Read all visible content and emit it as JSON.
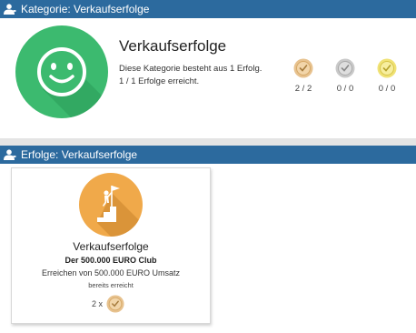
{
  "category_header": {
    "title": "Kategorie: Verkaufserfolge",
    "icon": "user-icon"
  },
  "category": {
    "icon": "smiley-face-icon",
    "icon_color": "#3cba6f",
    "title": "Verkaufserfolge",
    "description": "Diese Kategorie besteht aus 1 Erfolg.",
    "progress": "1 / 1 Erfolge erreicht.",
    "medals": [
      {
        "name": "bronze",
        "icon": "bronze-medal-icon",
        "color": "#e7c28f",
        "count": "2 / 2"
      },
      {
        "name": "silver",
        "icon": "silver-medal-icon",
        "color": "#c9c9c9",
        "count": "0 / 0"
      },
      {
        "name": "gold",
        "icon": "gold-medal-icon",
        "color": "#f0e275",
        "count": "0 / 0"
      }
    ]
  },
  "achievements_header": {
    "title": "Erfolge: Verkaufserfolge",
    "icon": "user-icon"
  },
  "achievement": {
    "icon": "summit-flag-climber-icon",
    "icon_color": "#f0a94a",
    "title": "Verkaufserfolge",
    "name": "Der 500.000 EURO Club",
    "description": "Erreichen von 500.000 EURO Umsatz",
    "status": "bereits erreicht",
    "count": "2 x",
    "medal_icon": "bronze-medal-icon"
  },
  "colors": {
    "header_bg": "#2c6a9e",
    "header_text": "#ffffff"
  }
}
